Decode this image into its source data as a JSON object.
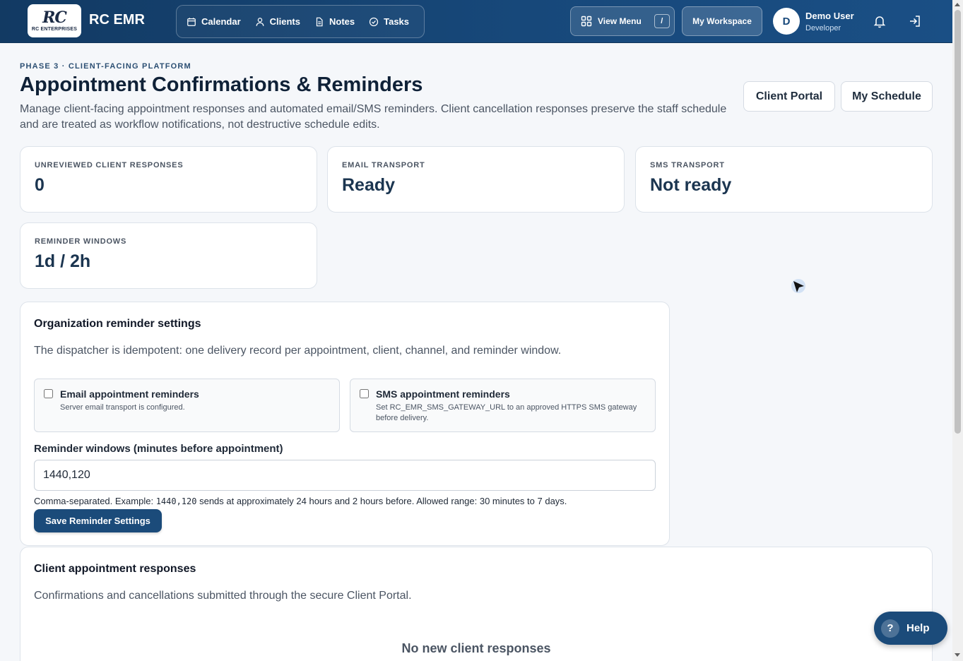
{
  "brand": {
    "logo_mark": "RC",
    "logo_sub": "RC ENTERPRISES",
    "name": "RC EMR"
  },
  "nav": [
    {
      "label": "Calendar",
      "icon": "calendar-icon"
    },
    {
      "label": "Clients",
      "icon": "user-icon"
    },
    {
      "label": "Notes",
      "icon": "document-icon"
    },
    {
      "label": "Tasks",
      "icon": "check-circle-icon"
    }
  ],
  "topbar": {
    "view_menu_label": "View Menu",
    "view_menu_shortcut": "/",
    "workspace_label": "My Workspace",
    "user_initial": "D",
    "user_name": "Demo User",
    "user_role": "Developer"
  },
  "header": {
    "eyebrow": "PHASE 3 · CLIENT-FACING PLATFORM",
    "title": "Appointment Confirmations & Reminders",
    "description": "Manage client-facing appointment responses and automated email/SMS reminders. Client cancellation responses preserve the staff schedule and are treated as workflow notifications, not destructive schedule edits.",
    "client_portal_label": "Client Portal",
    "my_schedule_label": "My Schedule"
  },
  "stats": [
    {
      "label": "UNREVIEWED CLIENT RESPONSES",
      "value": "0"
    },
    {
      "label": "EMAIL TRANSPORT",
      "value": "Ready"
    },
    {
      "label": "SMS TRANSPORT",
      "value": "Not ready"
    },
    {
      "label": "REMINDER WINDOWS",
      "value": "1d / 2h"
    }
  ],
  "reminder_settings": {
    "title": "Organization reminder settings",
    "description": "The dispatcher is idempotent: one delivery record per appointment, client, channel, and reminder window.",
    "email_option": {
      "title": "Email appointment reminders",
      "subtitle": "Server email transport is configured.",
      "checked": false
    },
    "sms_option": {
      "title": "SMS appointment reminders",
      "subtitle": "Set RC_EMR_SMS_GATEWAY_URL to an approved HTTPS SMS gateway before delivery.",
      "checked": false
    },
    "windows_label": "Reminder windows (minutes before appointment)",
    "windows_value": "1440,120",
    "help_prefix": "Comma-separated. Example: ",
    "help_code": "1440,120",
    "help_suffix": " sends at approximately 24 hours and 2 hours before. Allowed range: 30 minutes to 7 days.",
    "save_label": "Save Reminder Settings"
  },
  "responses": {
    "title": "Client appointment responses",
    "description": "Confirmations and cancellations submitted through the secure Client Portal.",
    "empty_text": "No new client responses"
  },
  "help": {
    "icon_text": "?",
    "label": "Help"
  }
}
